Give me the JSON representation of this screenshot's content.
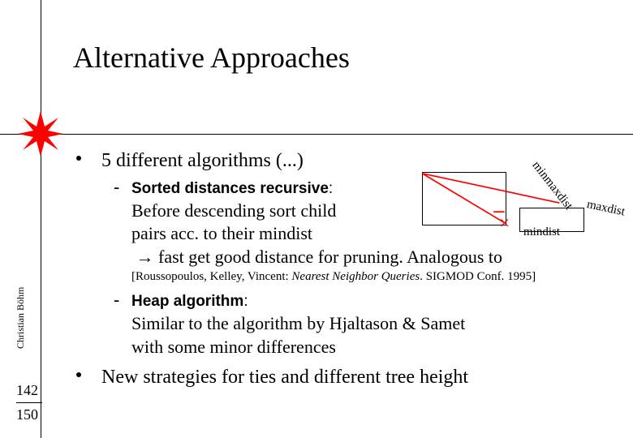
{
  "title": "Alternative Approaches",
  "bullet1": "5 different algorithms (...)",
  "sub1": {
    "label": "Sorted distances recursive",
    "colon": ":",
    "body1": "Before descending sort child",
    "body2": "pairs acc. to their mindist",
    "body3_arrow": "→",
    "body3": " fast get good distance for pruning. Analogous to"
  },
  "citation": {
    "open": "[Roussopoulos, Kelley, Vincent: ",
    "title": "Nearest Neighbor Queries",
    "close": ". SIGMOD Conf. 1995]"
  },
  "sub2": {
    "label": "Heap algorithm",
    "colon": ":",
    "body1": "Similar to the algorithm by Hjaltason & Samet",
    "body2": "with some minor differences"
  },
  "bullet2": "New strategies for ties and different tree height",
  "diagram": {
    "mindist": "mindist",
    "minmaxdist": "minmaxdist",
    "maxdist": "maxdist"
  },
  "author": "Christian Böhm",
  "page_current": "142",
  "page_total": "150"
}
